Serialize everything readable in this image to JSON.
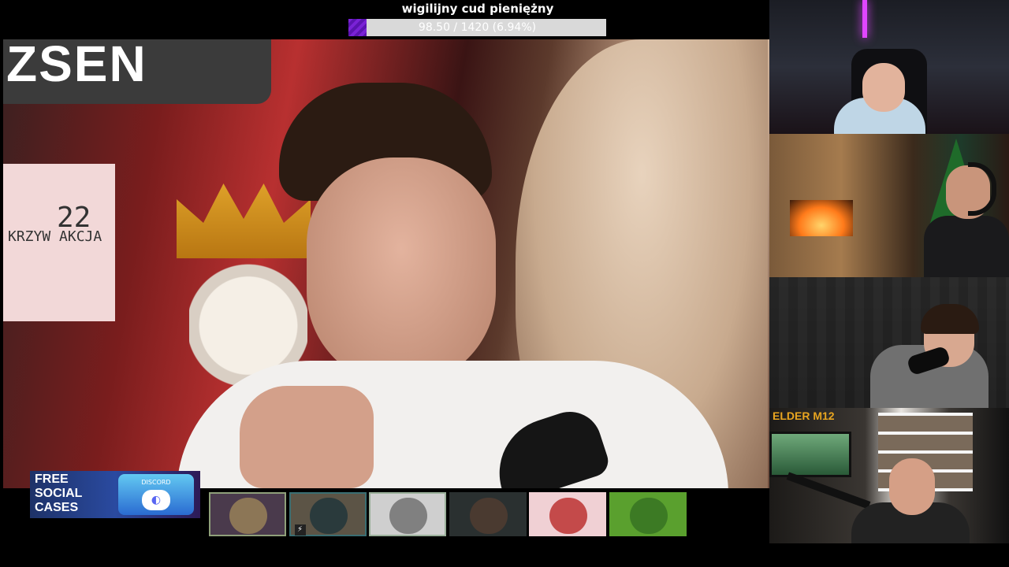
{
  "goal": {
    "title": "wigilijny cud pieniężny",
    "progress_text": "98.50 / 1420 (6.94%)",
    "current": 98.5,
    "target": 1420,
    "percent": 6.94,
    "fill_color": "#7a22d6"
  },
  "main_video": {
    "sign_text": "ZSEN",
    "board_number": "22",
    "board_text": "KRZYW AKCJA"
  },
  "ad_banner": {
    "lines": [
      "FREE",
      "SOCIAL",
      "CASES"
    ],
    "box_label": "DISCORD",
    "icon": "discord-icon"
  },
  "alerts": [
    {
      "name": "alert-tile-1",
      "bg": "#4a3a4c",
      "thumb": "#8c7656",
      "border": "#8fa07a",
      "icon": "face-avatar"
    },
    {
      "name": "alert-tile-2",
      "bg": "#5c5446",
      "thumb": "#2a3a3c",
      "border": "#3a6e72",
      "icon": "character-avatar",
      "badge": "⚡"
    },
    {
      "name": "alert-tile-3",
      "bg": "#cfcfcf",
      "thumb": "#808080",
      "border": "#9ab09a",
      "icon": "car-avatar"
    },
    {
      "name": "alert-tile-4",
      "bg": "#2a3030",
      "thumb": "#4a3a30",
      "border": "#2a3030",
      "icon": "person-avatar"
    },
    {
      "name": "alert-tile-5",
      "bg": "#f0d0d4",
      "thumb": "#c44a4a",
      "border": "#f0d0d4",
      "icon": "nfx-avatar"
    },
    {
      "name": "alert-tile-6",
      "bg": "#5aa02e",
      "thumb": "#3c7a24",
      "border": "#5aa02e",
      "icon": "pepe-avatar"
    }
  ],
  "cams": {
    "cam4_logo": "ELDER M12"
  }
}
